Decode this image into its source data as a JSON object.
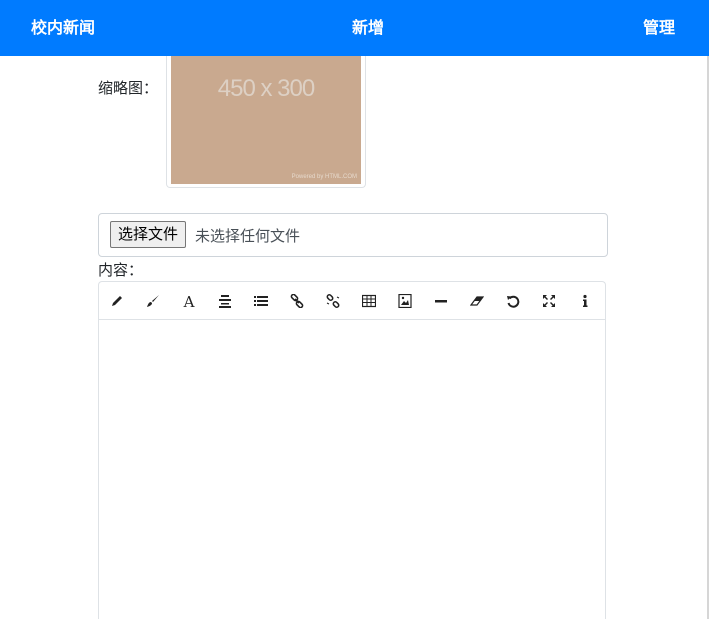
{
  "navbar": {
    "brand": "校内新闻",
    "page_title": "新增",
    "manage_link": "管理",
    "background_color": "#007bff"
  },
  "thumbnail": {
    "label": "缩略图：",
    "placeholder_text": "450 x 300",
    "placeholder_credit": "Powered by HTML.COM",
    "placeholder_color": "#c9a98f"
  },
  "file_input": {
    "button_label": "选择文件",
    "status_text": "未选择任何文件"
  },
  "content": {
    "label": "内容：",
    "toolbar": [
      {
        "icon": "pencil-icon",
        "name": "toolbar-pencil-button"
      },
      {
        "icon": "brush-icon",
        "name": "toolbar-brush-button"
      },
      {
        "icon": "font-icon",
        "name": "toolbar-font-button"
      },
      {
        "icon": "align-center-icon",
        "name": "toolbar-align-button"
      },
      {
        "icon": "list-icon",
        "name": "toolbar-list-button"
      },
      {
        "icon": "link-icon",
        "name": "toolbar-link-button"
      },
      {
        "icon": "unlink-icon",
        "name": "toolbar-unlink-button"
      },
      {
        "icon": "table-icon",
        "name": "toolbar-table-button"
      },
      {
        "icon": "image-icon",
        "name": "toolbar-image-button"
      },
      {
        "icon": "horizontal-rule-icon",
        "name": "toolbar-hr-button"
      },
      {
        "icon": "eraser-icon",
        "name": "toolbar-eraser-button"
      },
      {
        "icon": "undo-icon",
        "name": "toolbar-undo-button"
      },
      {
        "icon": "fullscreen-icon",
        "name": "toolbar-fullscreen-button"
      },
      {
        "icon": "info-icon",
        "name": "toolbar-info-button"
      }
    ],
    "body_text": ""
  }
}
